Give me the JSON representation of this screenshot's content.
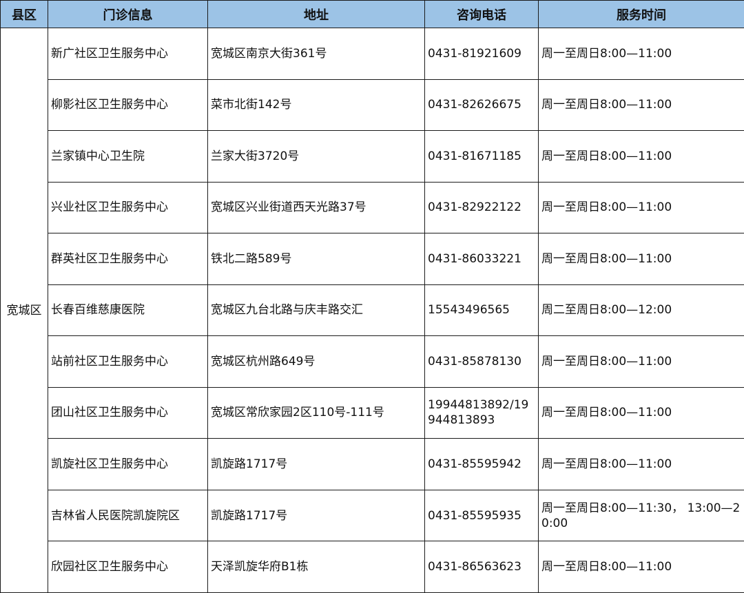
{
  "headers": [
    "县区",
    "门诊信息",
    "地址",
    "咨询电话",
    "服务时间"
  ],
  "district": "宽城区",
  "rows": [
    {
      "name": "新广社区卫生服务中心",
      "address": "宽城区南京大街361号",
      "phone": "0431-81921609",
      "hours": "周一至周日8:00—11:00"
    },
    {
      "name": "柳影社区卫生服务中心",
      "address": "菜市北街142号",
      "phone": "0431-82626675",
      "hours": "周一至周日8:00—11:00"
    },
    {
      "name": "兰家镇中心卫生院",
      "address": "兰家大街3720号",
      "phone": "0431-81671185",
      "hours": "周一至周日8:00—11:00"
    },
    {
      "name": "兴业社区卫生服务中心",
      "address": "宽城区兴业街道西天光路37号",
      "phone": "0431-82922122",
      "hours": "周一至周日8:00—11:00"
    },
    {
      "name": "群英社区卫生服务中心",
      "address": "铁北二路589号",
      "phone": "0431-86033221",
      "hours": "周一至周日8:00—11:00"
    },
    {
      "name": "长春百维慈康医院",
      "address": "宽城区九台北路与庆丰路交汇",
      "phone": "15543496565",
      "hours": "周二至周日8:00—12:00"
    },
    {
      "name": "站前社区卫生服务中心",
      "address": "宽城区杭州路649号",
      "phone": "0431-85878130",
      "hours": "周一至周日8:00—11:00"
    },
    {
      "name": "团山社区卫生服务中心",
      "address": "宽城区常欣家园2区110号-111号",
      "phone": "19944813892/19944813893",
      "hours": "周一至周日8:00—11:00"
    },
    {
      "name": "凯旋社区卫生服务中心",
      "address": "凯旋路1717号",
      "phone": "0431-85595942",
      "hours": "周一至周日8:00—11:00"
    },
    {
      "name": "吉林省人民医院凯旋院区",
      "address": "凯旋路1717号",
      "phone": "0431-85595935",
      "hours": "周一至周日8:00—11:30， 13:00—20:00"
    },
    {
      "name": "欣园社区卫生服务中心",
      "address": "天泽凯旋华府B1栋",
      "phone": "0431-86563623",
      "hours": "周一至周日8:00—11:00"
    }
  ]
}
